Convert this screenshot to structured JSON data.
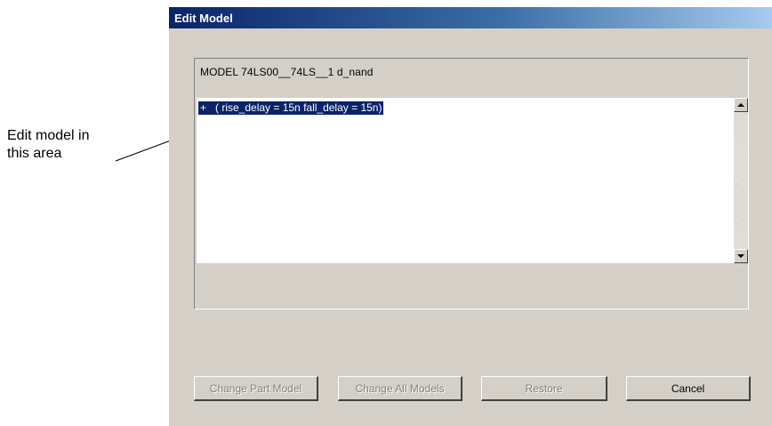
{
  "annotation": {
    "line1": "Edit model in",
    "line2": "this area"
  },
  "dialog": {
    "title": "Edit Model",
    "model_header": "MODEL 74LS00__74LS__1 d_nand",
    "editor_text": "+   ( rise_delay = 15n fall_delay = 15n)",
    "buttons": {
      "change_part_model": "Change Part Model",
      "change_all_models": "Change All Models",
      "restore": "Restore",
      "cancel": "Cancel"
    }
  },
  "colors": {
    "dialog_bg": "#d4d0c8",
    "title_gradient_start": "#0a246a",
    "title_gradient_end": "#a6caf0",
    "selection": "#0a246a"
  },
  "icons": [
    "scroll-up-arrow-icon",
    "scroll-down-arrow-icon"
  ]
}
